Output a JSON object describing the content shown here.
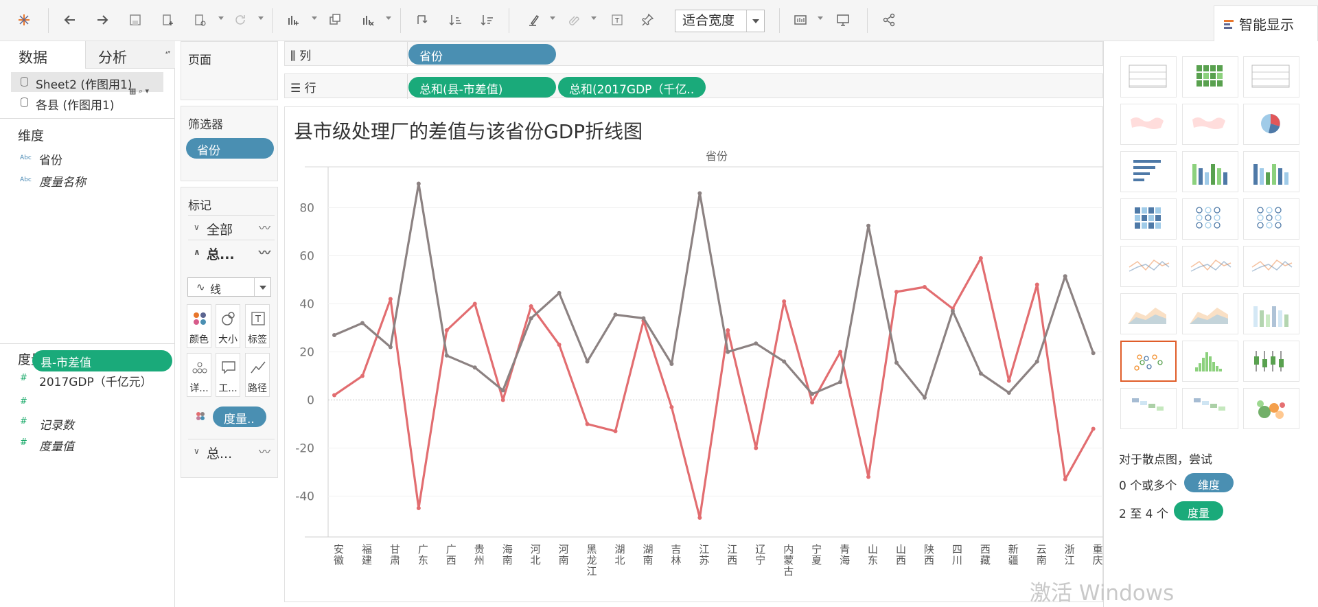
{
  "toolbar": {
    "fit_label": "适合宽度",
    "smart_show_label": "智能显示"
  },
  "left_pane": {
    "tabs": [
      "数据",
      "分析"
    ],
    "data_sources": [
      "Sheet2 (作图用1)",
      "各县 (作图用1)"
    ],
    "dimensions_header": "维度",
    "dimensions": [
      "省份",
      "度量名称"
    ],
    "measures_header": "度量",
    "measures": [
      "2017GDP（千亿元）",
      "县-市差值",
      "记录数",
      "度量值"
    ]
  },
  "shelves": {
    "pages_label": "页面",
    "filters_label": "筛选器",
    "filter_pill": "省份",
    "marks_label": "标记",
    "marks_all": "全部",
    "marks_sum1": "总...",
    "marks_sum2": "总...",
    "mark_type": "线",
    "mark_buttons": [
      "颜色",
      "大小",
      "标签",
      "详...",
      "工...",
      "路径"
    ],
    "mark_measure_pill": "度量..",
    "columns_label": "列",
    "rows_label": "行",
    "columns_pill": "省份",
    "rows_pills": [
      "总和(县-市差值)",
      "总和(2017GDP（千亿.."
    ]
  },
  "chart_data": {
    "type": "line",
    "title": "县市级处理厂的差值与该省份GDP折线图",
    "xlabel": "省份",
    "ylabel": "",
    "ylim": [
      -57,
      97
    ],
    "yticks": [
      -40,
      -20,
      0,
      20,
      40,
      60,
      80
    ],
    "grid": true,
    "categories": [
      "安徽",
      "福建",
      "甘肃",
      "广东",
      "广西",
      "贵州",
      "海南",
      "河北",
      "河南",
      "黑龙江",
      "湖北",
      "湖南",
      "吉林",
      "江苏",
      "江西",
      "辽宁",
      "内蒙古",
      "宁夏",
      "青海",
      "山东",
      "山西",
      "陕西",
      "四川",
      "西藏",
      "新疆",
      "云南",
      "浙江",
      "重庆"
    ],
    "series": [
      {
        "color": "#e26d70",
        "values": [
          2,
          10,
          42,
          -45,
          29,
          40,
          0,
          39,
          23,
          -10,
          -13,
          33,
          -3,
          -49,
          29,
          -20,
          41,
          -1,
          20,
          -32,
          45,
          47,
          38,
          59,
          8,
          48,
          -33,
          -12
        ]
      },
      {
        "color": "#8c8282",
        "values": [
          27,
          32,
          22,
          90,
          18.5,
          13.5,
          4,
          34,
          44.5,
          16,
          35.5,
          34,
          15,
          86,
          20,
          23.5,
          16,
          2.5,
          7.5,
          72.5,
          15.5,
          1,
          37,
          11,
          3,
          16,
          51.5,
          19.5
        ]
      }
    ]
  },
  "smart_panel": {
    "hint_title": "对于散点图，尝试",
    "hint_line1_prefix": "0 个或多个",
    "hint_line1_pill": "维度",
    "hint_line2_prefix": "2 至 4 个",
    "hint_line2_pill": "度量"
  },
  "watermark": "激活 Windows"
}
